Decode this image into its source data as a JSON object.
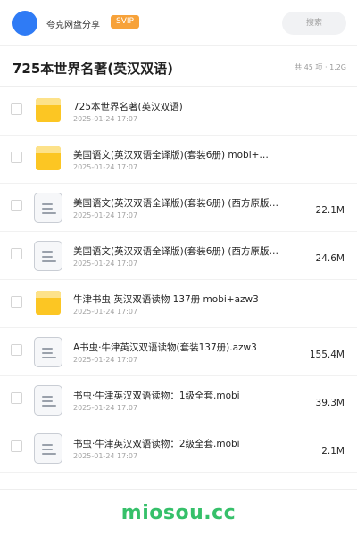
{
  "header": {
    "brand": "夸克网盘分享",
    "badge": "SVIP",
    "search_placeholder": "搜索"
  },
  "title_bar": {
    "title": "725本世界名著(英汉双语)",
    "meta": "共 45 项 · 1.2G"
  },
  "files": [
    {
      "type": "folder",
      "icon": "folder-icon",
      "name": "725本世界名著(英汉双语)",
      "date": "2025-01-24 17:07",
      "size": ""
    },
    {
      "type": "folder",
      "icon": "folder-icon",
      "name": "美国语文(英汉双语全译版)(套装6册) mobi+…",
      "date": "2025-01-24 17:07",
      "size": ""
    },
    {
      "type": "file",
      "icon": "document-icon",
      "name": "美国语文(英汉双语全译版)(套装6册) (西方原版…",
      "date": "2025-01-24 17:07",
      "size": "22.1M"
    },
    {
      "type": "file",
      "icon": "document-icon",
      "name": "美国语文(英汉双语全译版)(套装6册) (西方原版…",
      "date": "2025-01-24 17:07",
      "size": "24.6M"
    },
    {
      "type": "folder",
      "icon": "folder-icon",
      "name": "牛津书虫 英汉双语读物 137册 mobi+azw3",
      "date": "2025-01-24 17:07",
      "size": ""
    },
    {
      "type": "file",
      "icon": "document-icon",
      "name": "A书虫·牛津英汉双语读物(套装137册).azw3",
      "date": "2025-01-24 17:07",
      "size": "155.4M"
    },
    {
      "type": "file",
      "icon": "document-icon",
      "name": "书虫·牛津英汉双语读物：1级全套.mobi",
      "date": "2025-01-24 17:07",
      "size": "39.3M"
    },
    {
      "type": "file",
      "icon": "document-icon",
      "name": "书虫·牛津英汉双语读物：2级全套.mobi",
      "date": "2025-01-24 17:07",
      "size": "2.1M"
    }
  ],
  "footer": {
    "watermark": "miosou.cc"
  },
  "colors": {
    "accent_blue": "#2f7bf5",
    "svip_orange": "#f7a23a",
    "folder_yellow": "#fcc623",
    "watermark_green": "#36c06a"
  }
}
